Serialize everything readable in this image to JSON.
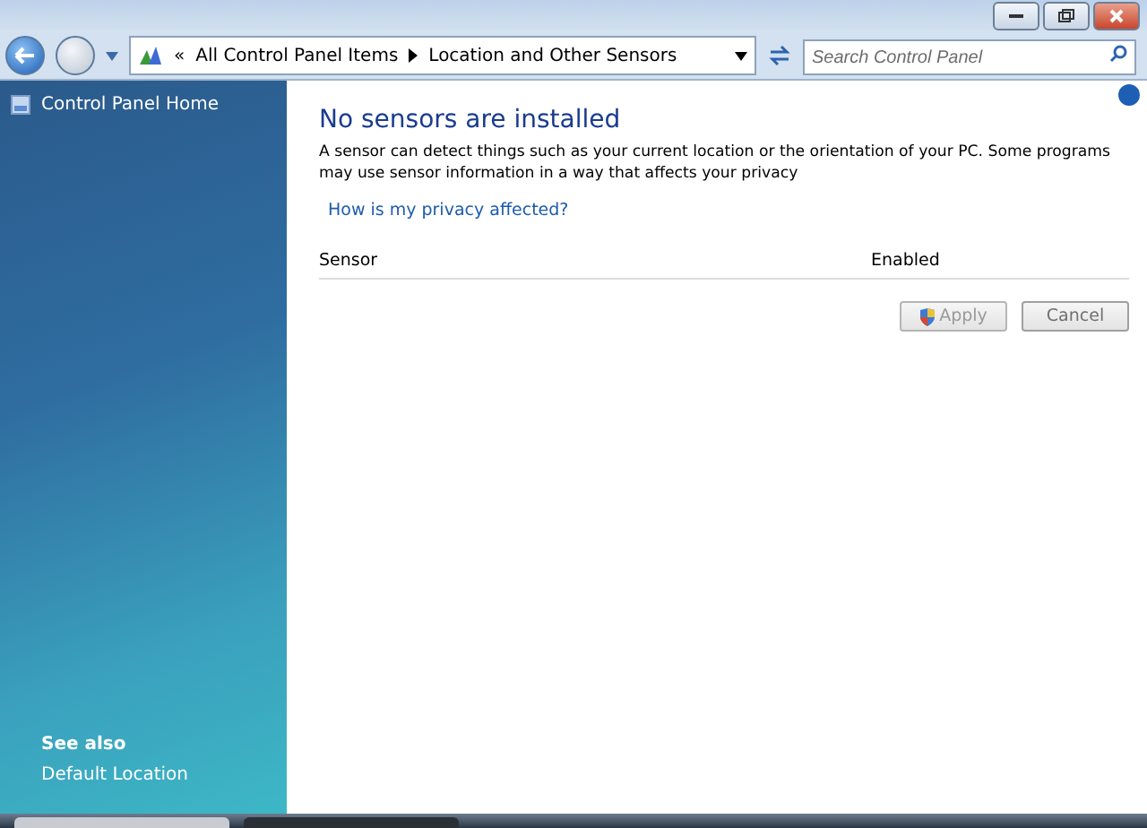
{
  "address_bar": {
    "overflow": "«",
    "breadcrumbs": [
      "All Control Panel Items",
      "Location and Other Sensors"
    ]
  },
  "search": {
    "placeholder": "Search Control Panel"
  },
  "sidebar": {
    "home": "Control Panel Home",
    "see_also_title": "See also",
    "links": [
      "Default Location"
    ]
  },
  "content": {
    "heading": "No sensors are installed",
    "description": "A sensor can detect things such as your current location or the orientation of your PC. Some programs may use sensor information in a way that affects your privacy",
    "privacy_link": "How is my privacy affected?",
    "table": {
      "columns": [
        "Sensor",
        "Enabled"
      ]
    },
    "buttons": [
      {
        "label": "Apply",
        "disabled": true,
        "shield": true
      },
      {
        "label": "Cancel",
        "disabled": false,
        "shield": false
      }
    ]
  }
}
